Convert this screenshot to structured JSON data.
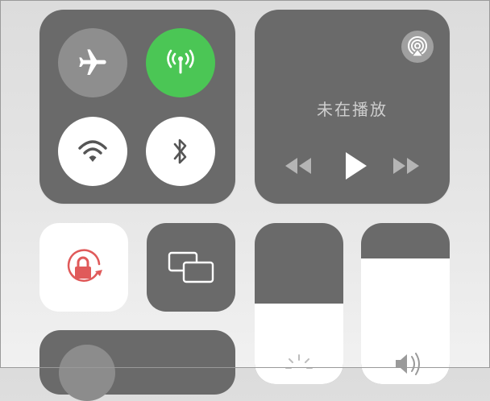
{
  "connectivity": {
    "airplane": {
      "icon": "airplane-icon",
      "state": "off"
    },
    "cellular": {
      "icon": "cellular-antenna-icon",
      "state": "on",
      "color": "#4bc655"
    },
    "wifi": {
      "icon": "wifi-icon",
      "state": "on"
    },
    "bluetooth": {
      "icon": "bluetooth-icon",
      "state": "on"
    }
  },
  "media": {
    "now_playing": "未在播放",
    "airplay_icon": "airplay-icon",
    "controls": [
      "rewind-icon",
      "play-icon",
      "fast-forward-icon"
    ]
  },
  "tiles": {
    "orientation_lock": {
      "icon": "orientation-lock-icon",
      "state": "on",
      "color": "#e05a5a"
    },
    "screen_mirroring": {
      "icon": "screen-mirroring-icon",
      "state": "off"
    }
  },
  "sliders": {
    "brightness": {
      "icon": "sun-icon",
      "level": 0.5
    },
    "volume": {
      "icon": "speaker-icon",
      "level": 0.78
    }
  },
  "colors": {
    "module_bg": "#6a6a6a",
    "accent_green": "#4bc655",
    "lock_red": "#e05a5a"
  }
}
